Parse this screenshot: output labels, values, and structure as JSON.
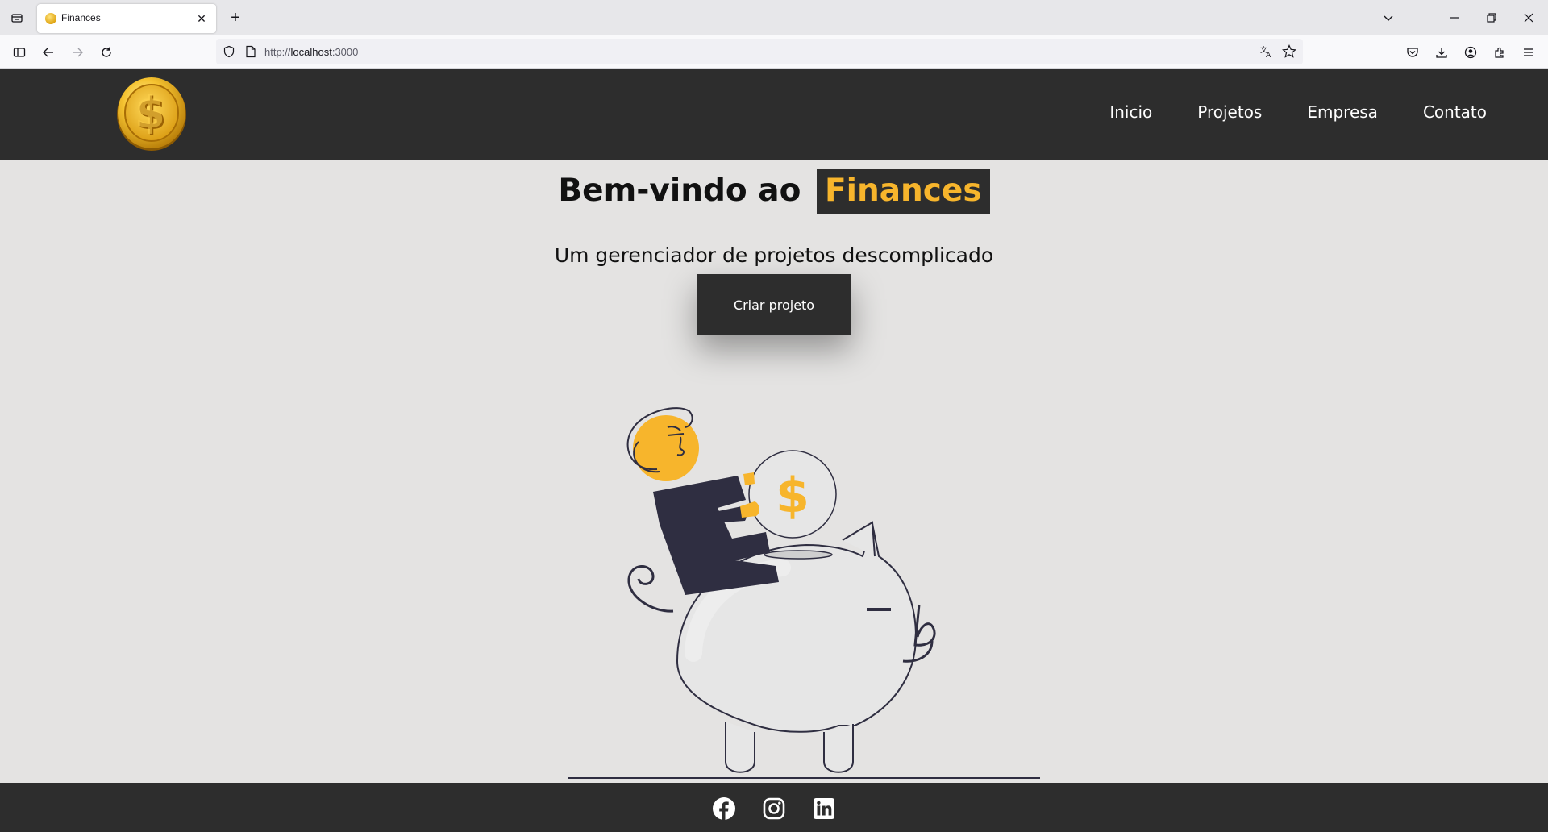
{
  "browser": {
    "tab_title": "Finances",
    "url_scheme": "http://",
    "url_host": "localhost",
    "url_port": ":3000"
  },
  "header": {
    "nav": [
      "Inicio",
      "Projetos",
      "Empresa",
      "Contato"
    ]
  },
  "hero": {
    "title_prefix": "Bem-vindo ao",
    "title_brand": "Finances",
    "subtitle": "Um gerenciador de projetos descomplicado",
    "cta_label": "Criar projeto"
  },
  "footer": {
    "social_icons": [
      "facebook-icon",
      "instagram-icon",
      "linkedin-icon"
    ]
  },
  "colors": {
    "accent": "#f7b52c",
    "dark": "#2d2d2d",
    "background": "#e4e3e2"
  }
}
